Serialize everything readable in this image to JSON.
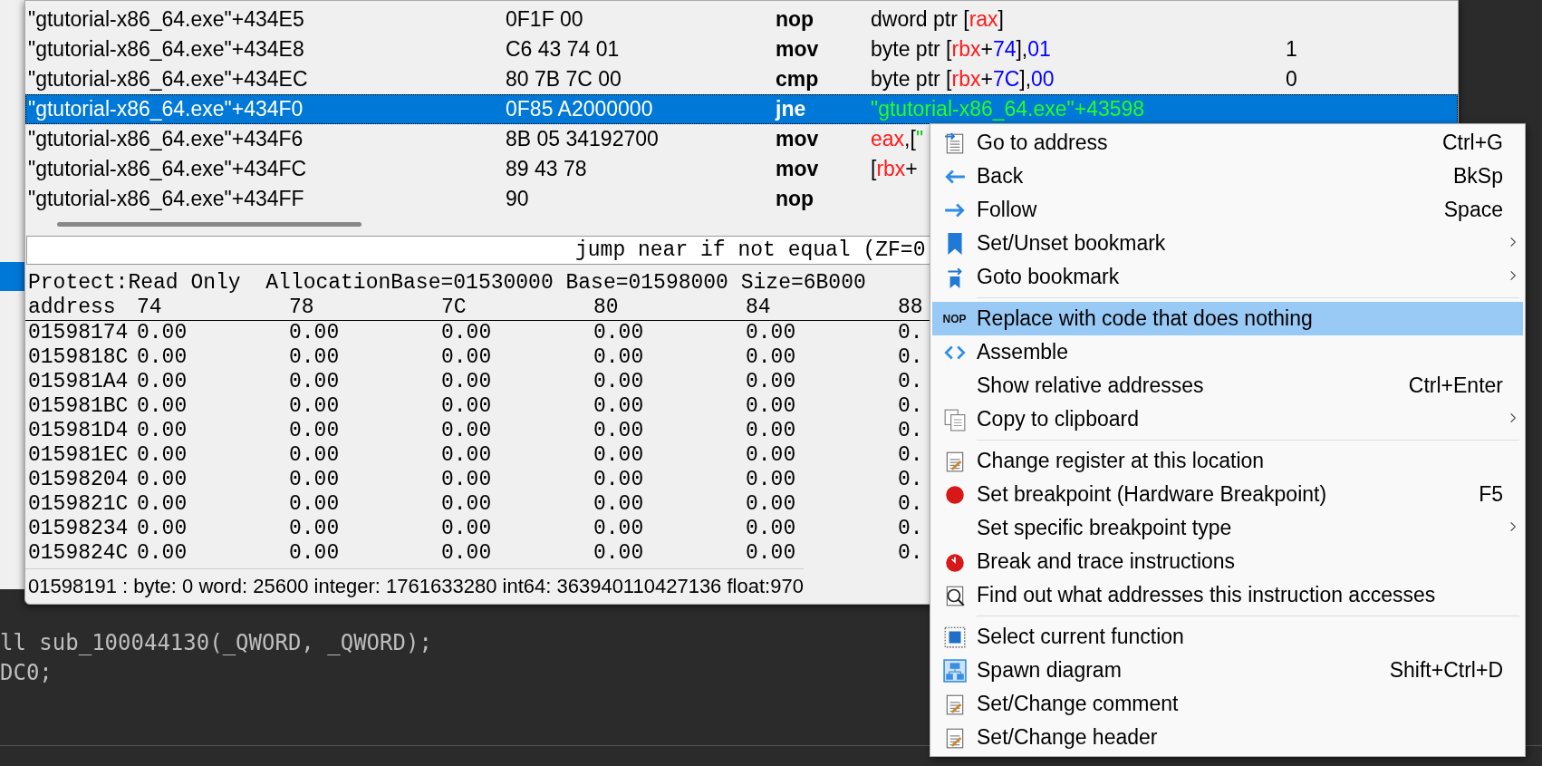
{
  "disassembly": {
    "rows": [
      {
        "address": "\"gtutorial-x86_64.exe\"+434E5",
        "bytes": "0F1F 00",
        "opcode": "nop",
        "operands": [
          {
            "text": "dword ptr [",
            "kind": "plain"
          },
          {
            "text": "rax",
            "kind": "register"
          },
          {
            "text": "]",
            "kind": "plain"
          }
        ],
        "selected": false
      },
      {
        "address": "\"gtutorial-x86_64.exe\"+434E8",
        "bytes": "C6 43 74 01",
        "opcode": "mov",
        "operands": [
          {
            "text": "byte ptr [",
            "kind": "plain"
          },
          {
            "text": "rbx",
            "kind": "register"
          },
          {
            "text": "+",
            "kind": "plain"
          },
          {
            "text": "74",
            "kind": "number"
          },
          {
            "text": "],",
            "kind": "plain"
          },
          {
            "text": "01",
            "kind": "number"
          }
        ],
        "comment": "1",
        "selected": false
      },
      {
        "address": "\"gtutorial-x86_64.exe\"+434EC",
        "bytes": "80 7B 7C 00",
        "opcode": "cmp",
        "operands": [
          {
            "text": "byte ptr [",
            "kind": "plain"
          },
          {
            "text": "rbx",
            "kind": "register"
          },
          {
            "text": "+",
            "kind": "plain"
          },
          {
            "text": "7C",
            "kind": "number"
          },
          {
            "text": "],",
            "kind": "plain"
          },
          {
            "text": "00",
            "kind": "number"
          }
        ],
        "comment": "0",
        "selected": false
      },
      {
        "address": "\"gtutorial-x86_64.exe\"+434F0",
        "bytes": "0F85 A2000000",
        "opcode": "jne",
        "operands": [
          {
            "text": "\"gtutorial-x86_64.exe\"+43598",
            "kind": "symbol"
          }
        ],
        "selected": true
      },
      {
        "address": "\"gtutorial-x86_64.exe\"+434F6",
        "bytes": "8B 05 34192700",
        "opcode": "mov",
        "operands": [
          {
            "text": "eax",
            "kind": "register"
          },
          {
            "text": ",[",
            "kind": "plain"
          },
          {
            "text": "\"",
            "kind": "symbol"
          }
        ],
        "selected": false
      },
      {
        "address": "\"gtutorial-x86_64.exe\"+434FC",
        "bytes": "89 43 78",
        "opcode": "mov",
        "operands": [
          {
            "text": "[",
            "kind": "plain"
          },
          {
            "text": "rbx",
            "kind": "register"
          },
          {
            "text": "+",
            "kind": "plain"
          }
        ],
        "selected": false
      },
      {
        "address": "\"gtutorial-x86_64.exe\"+434FF",
        "bytes": "90",
        "opcode": "nop",
        "operands": [],
        "selected": false
      }
    ]
  },
  "description": "jump near if not equal (ZF=0",
  "memory_view": {
    "info": "Protect:Read Only  AllocationBase=01530000 Base=01598000 Size=6B000",
    "columns": [
      "address",
      "74",
      "78",
      "7C",
      "80",
      "84",
      "88"
    ],
    "rows": [
      [
        "01598174",
        "0.00",
        "0.00",
        "0.00",
        "0.00",
        "0.00",
        "0."
      ],
      [
        "0159818C",
        "0.00",
        "0.00",
        "0.00",
        "0.00",
        "0.00",
        "0."
      ],
      [
        "015981A4",
        "0.00",
        "0.00",
        "0.00",
        "0.00",
        "0.00",
        "0."
      ],
      [
        "015981BC",
        "0.00",
        "0.00",
        "0.00",
        "0.00",
        "0.00",
        "0."
      ],
      [
        "015981D4",
        "0.00",
        "0.00",
        "0.00",
        "0.00",
        "0.00",
        "0."
      ],
      [
        "015981EC",
        "0.00",
        "0.00",
        "0.00",
        "0.00",
        "0.00",
        "0."
      ],
      [
        "01598204",
        "0.00",
        "0.00",
        "0.00",
        "0.00",
        "0.00",
        "0."
      ],
      [
        "0159821C",
        "0.00",
        "0.00",
        "0.00",
        "0.00",
        "0.00",
        "0."
      ],
      [
        "01598234",
        "0.00",
        "0.00",
        "0.00",
        "0.00",
        "0.00",
        "0."
      ],
      [
        "0159824C",
        "0.00",
        "0.00",
        "0.00",
        "0.00",
        "0.00",
        "0."
      ]
    ]
  },
  "status_bar": "01598191 : byte: 0 word: 25600 integer: 1761633280 int64: 363940110427136 float:970",
  "editor": {
    "lines": [
      "ll sub_100044130(_QWORD, _QWORD);",
      "DC0;"
    ]
  },
  "context_menu": {
    "groups": [
      {
        "items": [
          {
            "kind": "goto",
            "label": "Go to address",
            "shortcut": "Ctrl+G",
            "submenu": false,
            "selected": false
          },
          {
            "kind": "back",
            "label": "Back",
            "shortcut": "BkSp",
            "submenu": false,
            "selected": false
          },
          {
            "kind": "follow",
            "label": "Follow",
            "shortcut": "Space",
            "submenu": false,
            "selected": false
          },
          {
            "kind": "bookmark",
            "label": "Set/Unset bookmark",
            "submenu": true,
            "selected": false
          },
          {
            "kind": "goto_bookmark",
            "label": "Goto bookmark",
            "submenu": true,
            "selected": false
          }
        ]
      },
      {
        "items": [
          {
            "kind": "text",
            "icon_text": "NOP",
            "label": "Replace with code that does nothing",
            "submenu": false,
            "selected": true
          },
          {
            "kind": "assemble",
            "label": "Assemble",
            "submenu": false,
            "selected": false
          },
          {
            "kind": "plain",
            "label": "Show relative addresses",
            "shortcut": "Ctrl+Enter",
            "submenu": false,
            "selected": false
          },
          {
            "kind": "copy",
            "label": "Copy to clipboard",
            "submenu": true,
            "selected": false
          }
        ]
      },
      {
        "items": [
          {
            "kind": "edit",
            "label": "Change register at this location",
            "submenu": false,
            "selected": false
          },
          {
            "kind": "breakpoint",
            "label": "Set breakpoint (Hardware Breakpoint)",
            "shortcut": "F5",
            "submenu": false,
            "selected": false
          },
          {
            "kind": "plain",
            "label": "Set specific breakpoint type",
            "submenu": true,
            "selected": false
          },
          {
            "kind": "trace",
            "label": "Break and trace instructions",
            "submenu": false,
            "selected": false
          },
          {
            "kind": "find",
            "label": "Find out what addresses this instruction accesses",
            "submenu": false,
            "selected": false
          }
        ]
      },
      {
        "items": [
          {
            "kind": "select_function",
            "label": "Select current function",
            "submenu": false,
            "selected": false
          },
          {
            "kind": "diagram",
            "label": "Spawn diagram",
            "shortcut": "Shift+Ctrl+D",
            "submenu": false,
            "selected": false
          },
          {
            "kind": "edit",
            "label": "Set/Change comment",
            "submenu": false,
            "selected": false
          },
          {
            "kind": "edit",
            "label": "Set/Change header",
            "submenu": false,
            "selected": false
          }
        ]
      }
    ]
  }
}
